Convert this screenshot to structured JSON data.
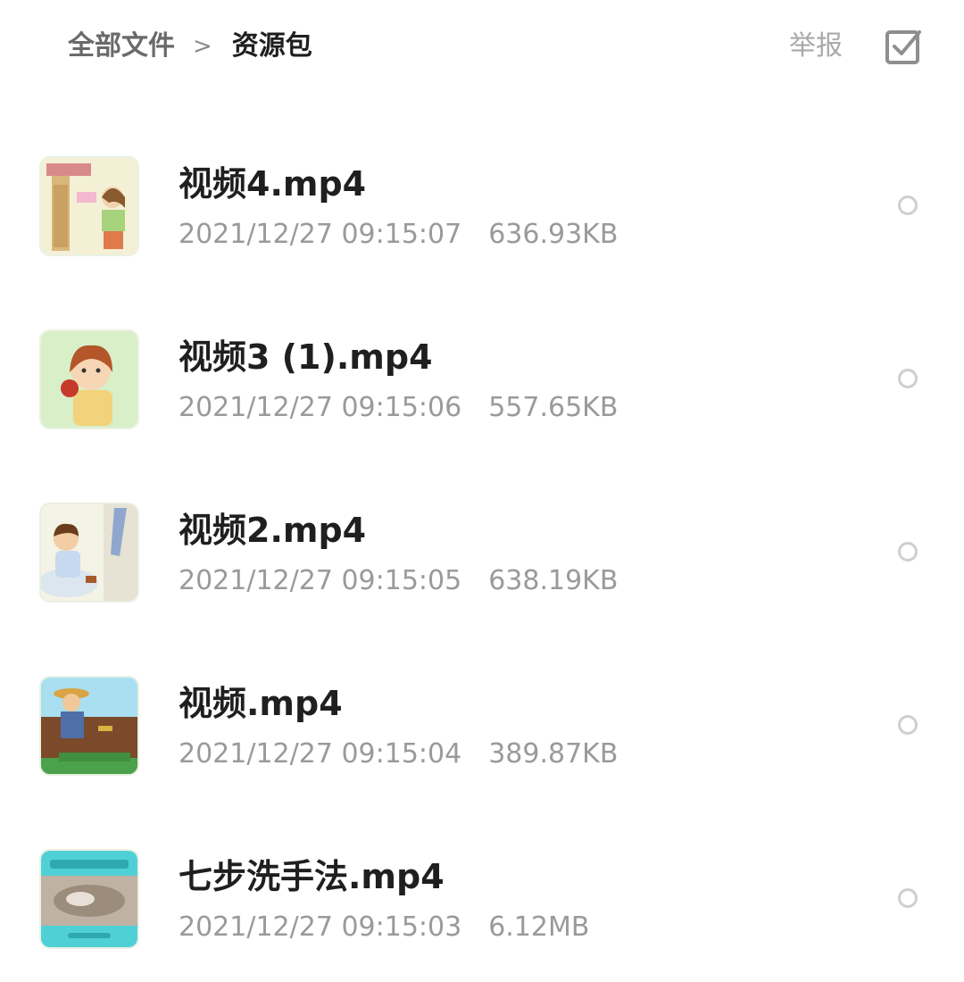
{
  "header": {
    "breadcrumb_root": "全部文件",
    "breadcrumb_separator": ">",
    "breadcrumb_current": "资源包",
    "report_label": "举报",
    "select_icon": "checkbox-icon"
  },
  "files": [
    {
      "name": "视频4.mp4",
      "date": "2021/12/27 09:15:07",
      "size": "636.93KB",
      "thumbnail": "girl-at-door"
    },
    {
      "name": "视频3 (1).mp4",
      "date": "2021/12/27 09:15:06",
      "size": "557.65KB",
      "thumbnail": "girl-eating"
    },
    {
      "name": "视频2.mp4",
      "date": "2021/12/27 09:15:05",
      "size": "638.19KB",
      "thumbnail": "boy-sitting"
    },
    {
      "name": "视频.mp4",
      "date": "2021/12/27 09:15:04",
      "size": "389.87KB",
      "thumbnail": "farmer-field"
    },
    {
      "name": "七步洗手法.mp4",
      "date": "2021/12/27 09:15:03",
      "size": "6.12MB",
      "thumbnail": "hand-washing"
    }
  ]
}
